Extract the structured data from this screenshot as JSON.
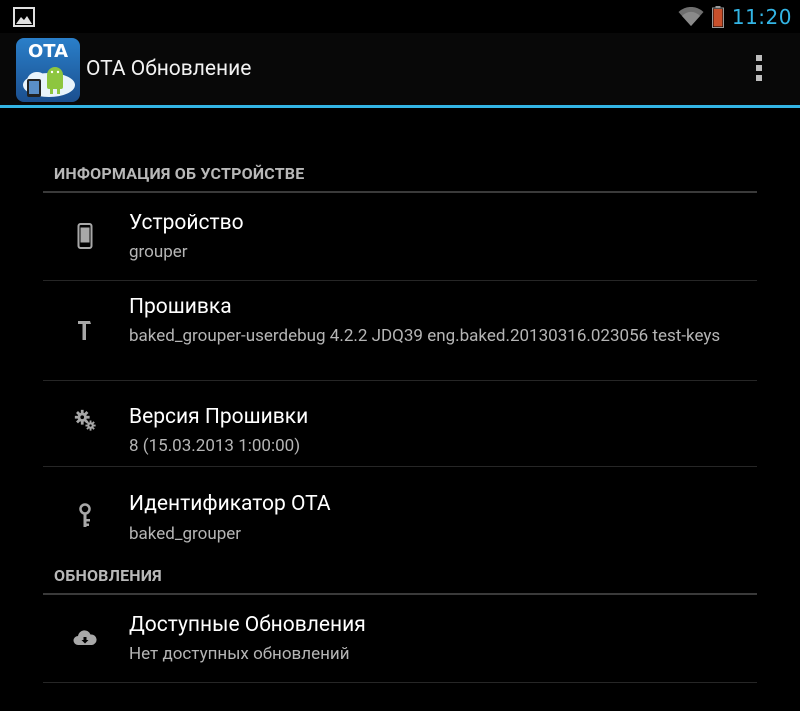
{
  "status_bar": {
    "time": "11:20",
    "icons": [
      "gallery-icon",
      "wifi-icon",
      "battery-icon"
    ]
  },
  "action_bar": {
    "app_icon_label": "OTA",
    "title": "OTA Обновление",
    "overflow_icon": "overflow-menu-icon"
  },
  "sections": [
    {
      "header": "ИНФОРМАЦИЯ ОБ УСТРОЙСТВЕ",
      "items": [
        {
          "icon": "phone-icon",
          "title": "Устройство",
          "summary": "grouper"
        },
        {
          "icon": "hammer-icon",
          "title": "Прошивка",
          "summary": "baked_grouper-userdebug 4.2.2 JDQ39 eng.baked.20130316.023056 test-keys"
        },
        {
          "icon": "gears-icon",
          "title": "Версия Прошивки",
          "summary": "8 (15.03.2013 1:00:00)"
        },
        {
          "icon": "key-icon",
          "title": "Идентификатор OTA",
          "summary": "baked_grouper"
        }
      ]
    },
    {
      "header": "ОБНОВЛЕНИЯ",
      "items": [
        {
          "icon": "cloud-download-icon",
          "title": "Доступные Обновления",
          "summary": "Нет доступных обновлений"
        }
      ]
    }
  ],
  "colors": {
    "accent": "#33b5e5",
    "background": "#000000",
    "category_text": "#b8b8b8",
    "summary_text": "#b5b5b5"
  }
}
